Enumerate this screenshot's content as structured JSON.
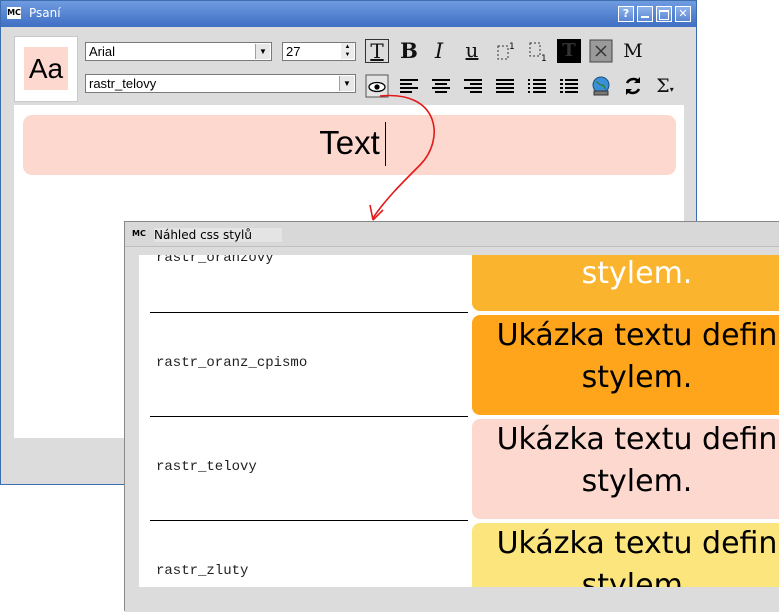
{
  "main_window": {
    "title": "Psaní",
    "logo": "MC",
    "buttons": {
      "help": "?",
      "minimize": "–",
      "maximize": "□",
      "close": "✕"
    }
  },
  "toolbar": {
    "preview_text": "Aa",
    "font_family": "Arial",
    "font_size": "27",
    "style_name": "rastr_telovy",
    "bold_label": "B",
    "italic_label": "I",
    "underline_label": "u",
    "math_label": "M",
    "sum_label": "Σ"
  },
  "editor": {
    "text": "Text"
  },
  "preview_window": {
    "title": "Náhled css stylů",
    "logo": "MC",
    "rows": [
      {
        "name": "rastr_oranzovy",
        "sample": "stylem.",
        "color": "#fbb42d"
      },
      {
        "name": "rastr_oranz_cpismo",
        "sample_line1": "Ukázka textu defin",
        "sample_line2": "stylem.",
        "color": "#ffa51b"
      },
      {
        "name": "rastr_telovy",
        "sample_line1": "Ukázka textu defin",
        "sample_line2": "stylem.",
        "color": "#fcd8cf"
      },
      {
        "name": "rastr_zluty",
        "sample_line1": "Ukázka textu defin",
        "sample_line2": "stylem.",
        "color": "#fbe57c"
      }
    ]
  },
  "colors": {
    "titlebar": "#4a7bd0",
    "arrow": "#e21a1a"
  }
}
